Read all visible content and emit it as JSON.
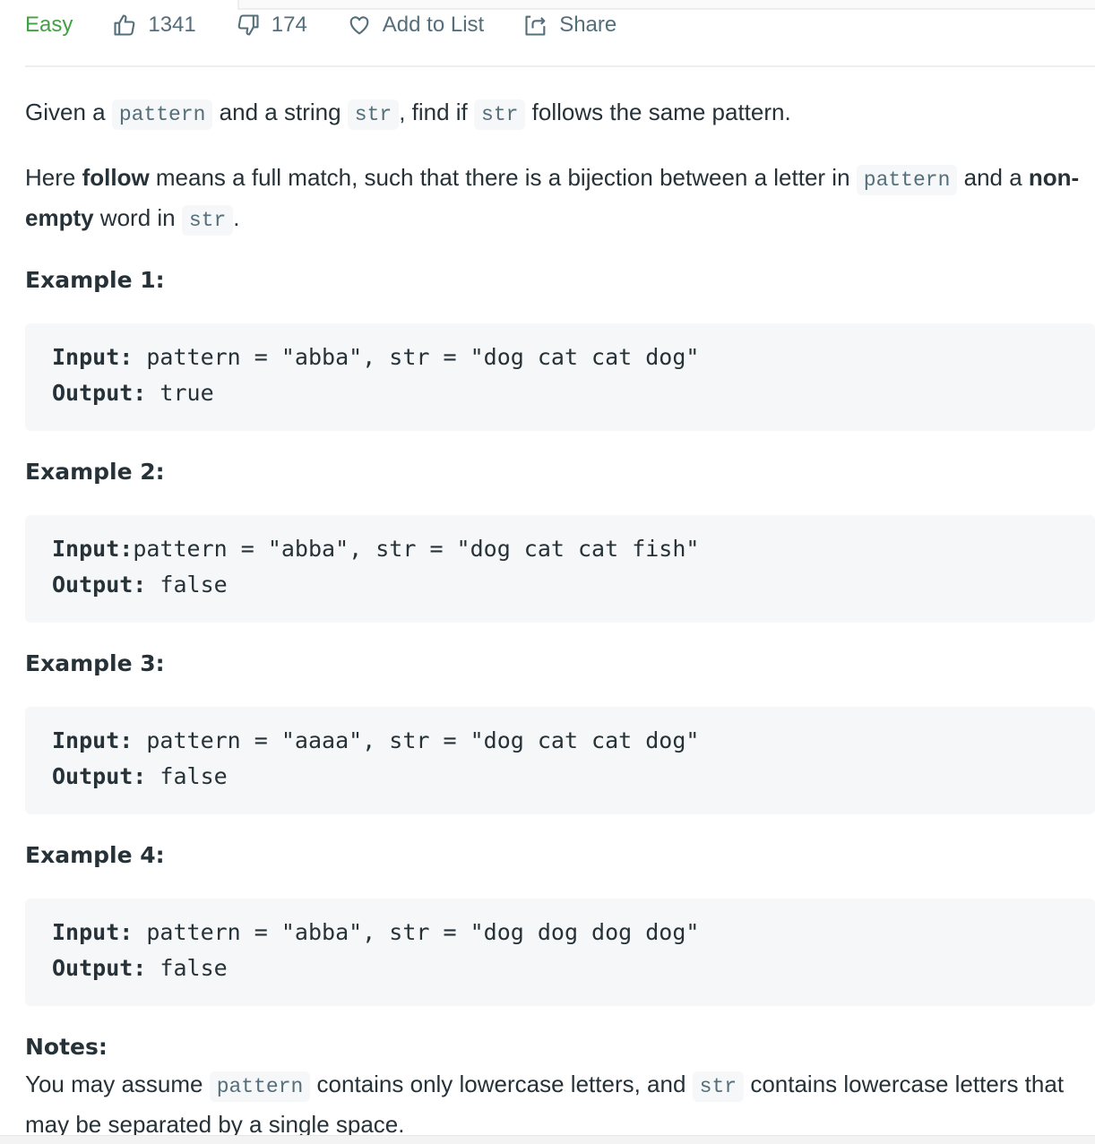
{
  "meta": {
    "difficulty": "Easy",
    "likes": "1341",
    "dislikes": "174",
    "add_to_list": "Add to List",
    "share": "Share",
    "difficulty_color": "#43a047",
    "icons": {
      "like": "thumbs-up-icon",
      "dislike": "thumbs-down-icon",
      "add_to_list": "heart-icon",
      "share": "share-icon"
    }
  },
  "description": {
    "p1": {
      "t1": "Given a ",
      "c1": "pattern",
      "t2": " and a string ",
      "c2": "str",
      "t3": ", find if ",
      "c3": "str",
      "t4": " follows the same pattern."
    },
    "p2": {
      "t1": "Here ",
      "b1": "follow",
      "t2": " means a full match, such that there is a bijection between a letter in ",
      "c1": "pattern",
      "t3": " and a ",
      "b2": "non-empty",
      "t4": " word in ",
      "c2": "str",
      "t5": "."
    }
  },
  "examples": [
    {
      "heading": "Example 1:",
      "input_label": "Input:",
      "input": " pattern = \"abba\", str = \"dog cat cat dog\"",
      "output_label": "Output:",
      "output": " true"
    },
    {
      "heading": "Example 2:",
      "input_label": "Input:",
      "input": "pattern = \"abba\", str = \"dog cat cat fish\"",
      "output_label": "Output:",
      "output": " false"
    },
    {
      "heading": "Example 3:",
      "input_label": "Input:",
      "input": " pattern = \"aaaa\", str = \"dog cat cat dog\"",
      "output_label": "Output:",
      "output": " false"
    },
    {
      "heading": "Example 4:",
      "input_label": "Input:",
      "input": " pattern = \"abba\", str = \"dog dog dog dog\"",
      "output_label": "Output:",
      "output": " false"
    }
  ],
  "notes": {
    "heading": "Notes:",
    "t1": "You may assume ",
    "c1": "pattern",
    "t2": " contains only lowercase letters, and ",
    "c2": "str",
    "t3": " contains lowercase letters that may be separated by a single space."
  }
}
